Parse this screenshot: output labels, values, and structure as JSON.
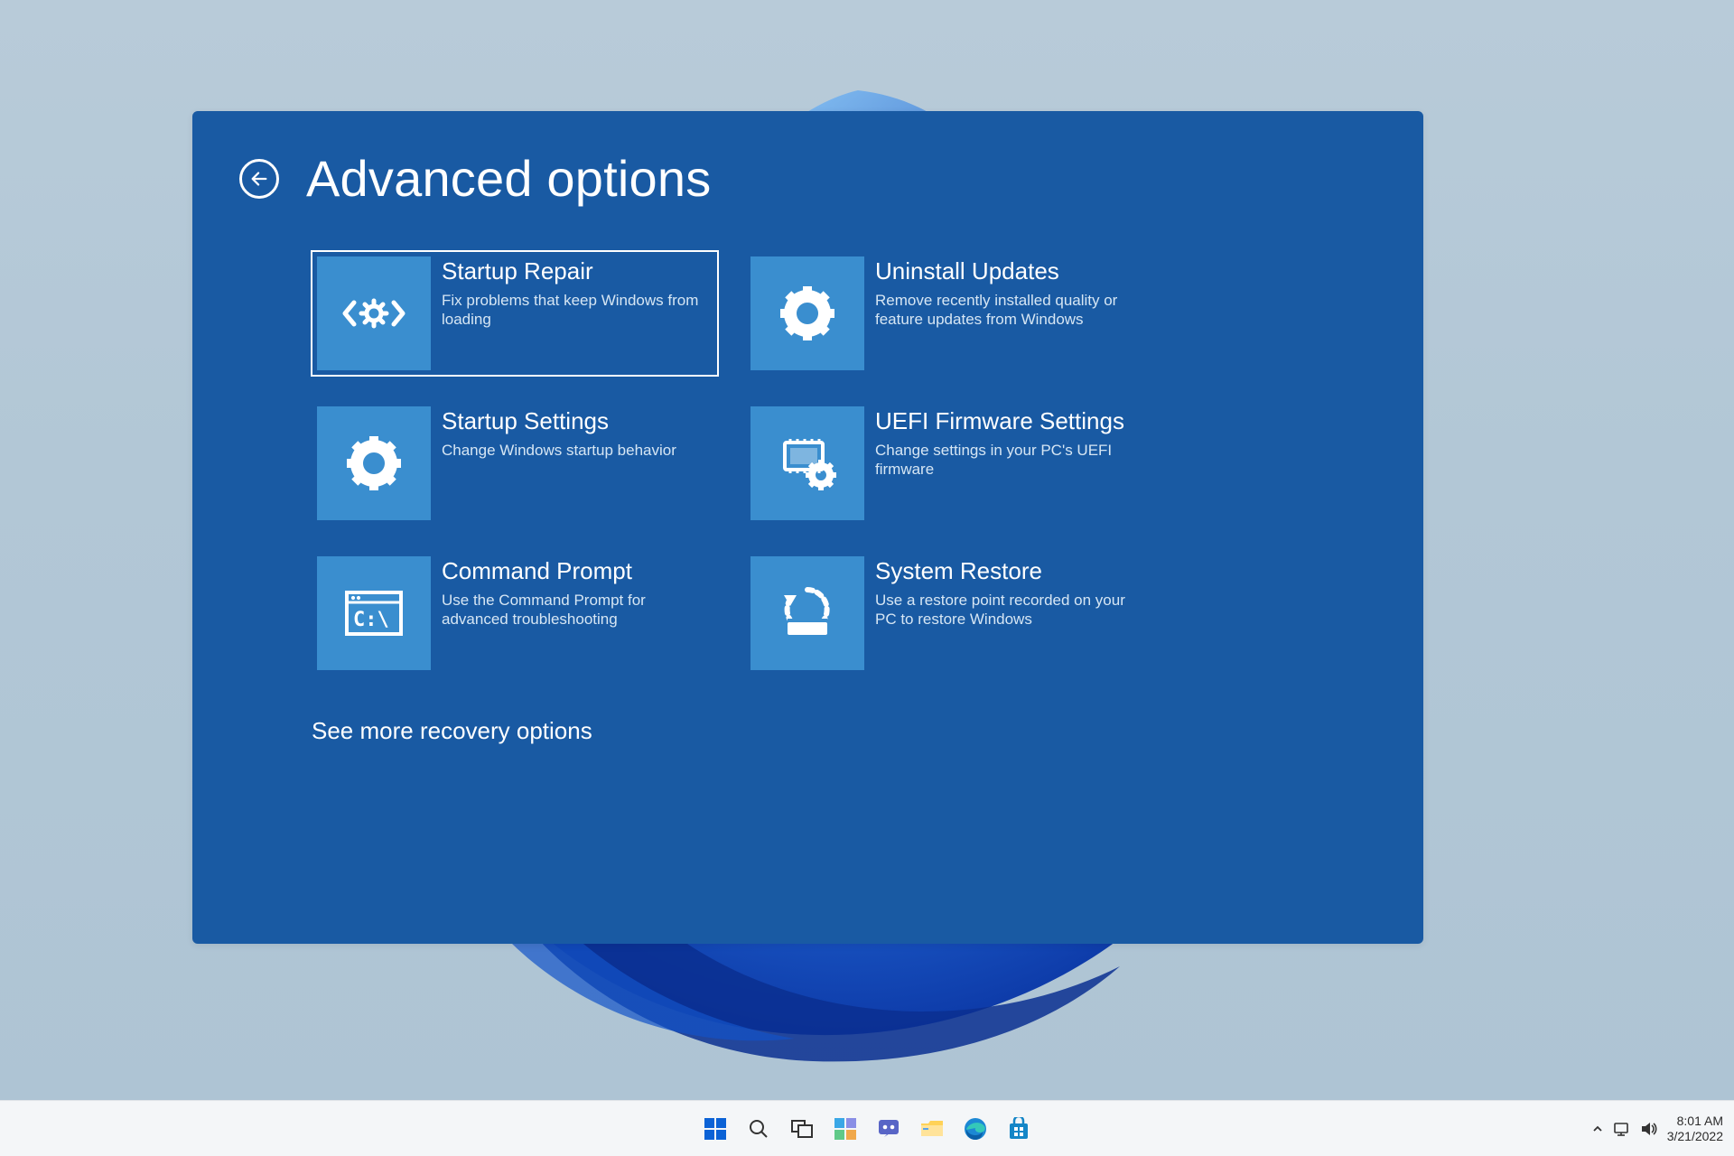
{
  "header": {
    "title": "Advanced options"
  },
  "tiles": [
    {
      "title": "Startup Repair",
      "desc": "Fix problems that keep Windows from loading"
    },
    {
      "title": "Uninstall Updates",
      "desc": "Remove recently installed quality or feature updates from Windows"
    },
    {
      "title": "Startup Settings",
      "desc": "Change Windows startup behavior"
    },
    {
      "title": "UEFI Firmware Settings",
      "desc": "Change settings in your PC's UEFI firmware"
    },
    {
      "title": "Command Prompt",
      "desc": "Use the Command Prompt for advanced troubleshooting"
    },
    {
      "title": "System Restore",
      "desc": "Use a restore point recorded on your PC to restore Windows"
    }
  ],
  "more_link": "See more recovery options",
  "taskbar": {
    "time": "8:01 AM",
    "date": "3/21/2022"
  }
}
